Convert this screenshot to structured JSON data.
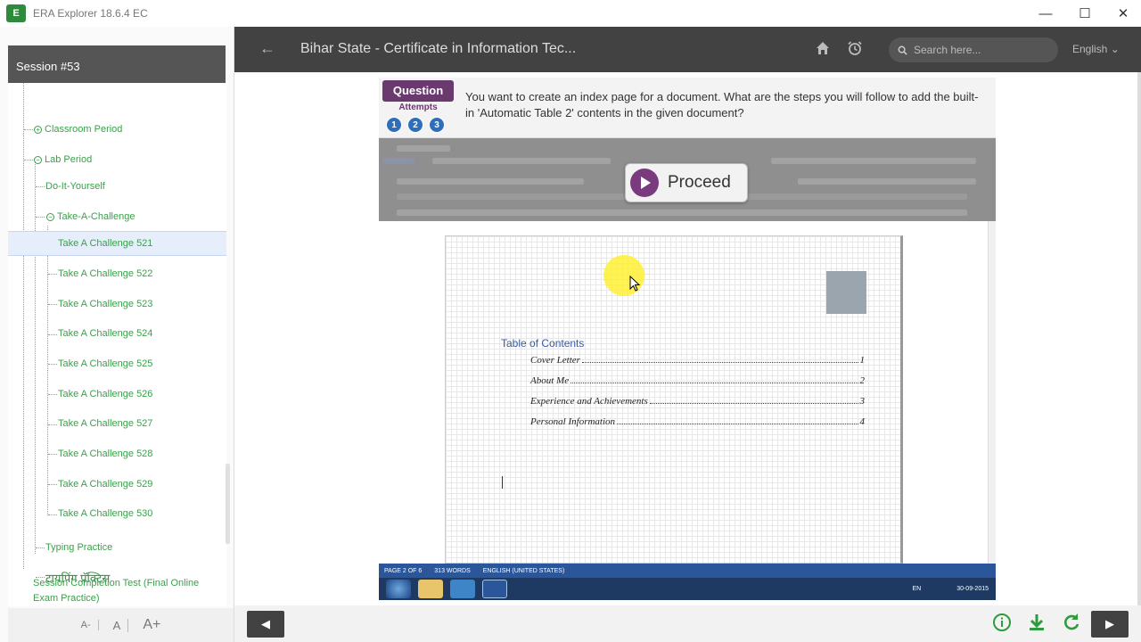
{
  "window": {
    "title": "ERA Explorer 18.6.4 EC",
    "logo_text": "E",
    "minimize": "—",
    "maximize": "☐",
    "close": "✕"
  },
  "sidebar": {
    "session": "Session #53",
    "items": [
      {
        "label": "Classroom Period",
        "prefix": "+"
      },
      {
        "label": "Lab Period",
        "prefix": "−"
      },
      {
        "label": "Do-It-Yourself"
      },
      {
        "label": "Take-A-Challenge",
        "prefix": "−"
      },
      {
        "label": "Take A Challenge 521"
      },
      {
        "label": "Take A Challenge 522"
      },
      {
        "label": "Take A Challenge 523"
      },
      {
        "label": "Take A Challenge 524"
      },
      {
        "label": "Take A Challenge 525"
      },
      {
        "label": "Take A Challenge 526"
      },
      {
        "label": "Take A Challenge 527"
      },
      {
        "label": "Take A Challenge 528"
      },
      {
        "label": "Take A Challenge 529"
      },
      {
        "label": "Take A Challenge 530"
      },
      {
        "label": "Typing Practice"
      },
      {
        "label": "टायपिंग प्रॅक्टिस"
      },
      {
        "label": "Session Completion Test (Final Online Exam Practice)"
      }
    ],
    "font_controls": [
      "A-",
      "A",
      "A+"
    ]
  },
  "header": {
    "title": "Bihar State - Certificate in Information Tec...",
    "search_placeholder": "Search here...",
    "language": "English"
  },
  "question": {
    "label": "Question",
    "attempts_label": "Attempts",
    "attempts": [
      "1",
      "2",
      "3"
    ],
    "text": "You want to create an index page for a document. What are the steps you will follow to add the built-in 'Automatic Table 2' contents in the given document?",
    "proceed": "Proceed"
  },
  "document": {
    "toc_title": "Table of Contents",
    "entries": [
      {
        "title": "Cover Letter",
        "page": "1"
      },
      {
        "title": "About Me",
        "page": "2"
      },
      {
        "title": "Experience and Achievements",
        "page": "3"
      },
      {
        "title": "Personal Information",
        "page": "4"
      }
    ],
    "status": [
      "PAGE 2 OF 6",
      "313 WORDS",
      "ENGLISH (UNITED STATES)"
    ],
    "tray_lang": "EN",
    "tray_date": "30-09-2015"
  },
  "colors": {
    "accent_green": "#3aa14a",
    "header_dark": "#424242",
    "question_purple": "#6a3a6e",
    "word_blue": "#2b579a"
  }
}
